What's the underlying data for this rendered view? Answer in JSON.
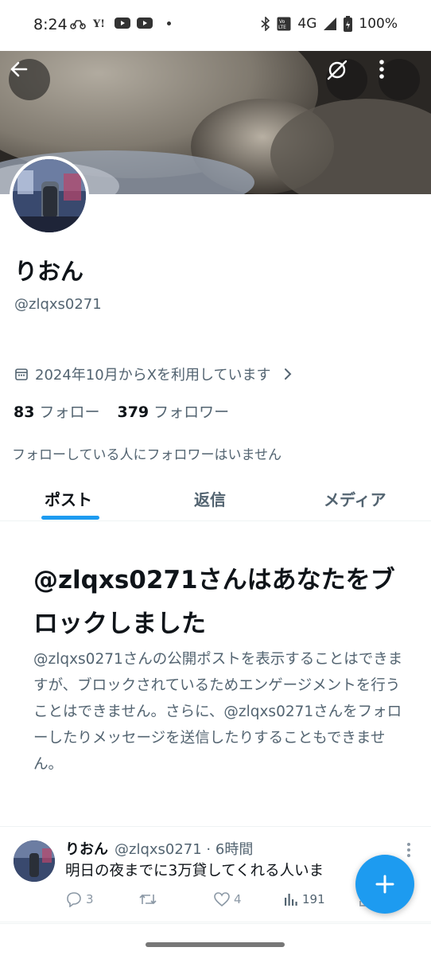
{
  "status_bar": {
    "time": "8:24",
    "network": "4G",
    "battery": "100%",
    "left_icons": [
      "scooter-icon",
      "yahoo-icon",
      "youtube-icon",
      "youtube-icon"
    ],
    "right_icons": [
      "bluetooth-icon",
      "volte-icon",
      "signal-icon",
      "battery-icon"
    ]
  },
  "header": {
    "back_icon": "arrow-left-icon",
    "grok_icon": "grok-icon",
    "more_icon": "more-vertical-icon"
  },
  "profile": {
    "display_name": "りおん",
    "handle": "@zlqxs0271",
    "joined": "2024年10月からXを利用しています",
    "following_count": "83",
    "following_label": "フォロー",
    "followers_count": "379",
    "followers_label": "フォロワー",
    "no_known_followers": "フォローしている人にフォロワーはいません"
  },
  "tabs": [
    {
      "label": "ポスト",
      "active": true
    },
    {
      "label": "返信",
      "active": false
    },
    {
      "label": "メディア",
      "active": false
    }
  ],
  "blocked": {
    "title": "@zlqxs0271さんはあなたをブロックしました",
    "body": "@zlqxs0271さんの公開ポストを表示することはできますが、ブロックされているためエンゲージメントを行うことはできません。さらに、@zlqxs0271さんをフォローしたりメッセージを送信したりすることもできません。"
  },
  "post": {
    "author_name": "りおん",
    "author_meta": "@zlqxs0271 · 6時間",
    "text": "明日の夜までに3万貸してくれる人いま",
    "replies": "3",
    "retweets": "",
    "likes": "4",
    "views": "191"
  },
  "colors": {
    "accent": "#1d9bf0",
    "text_primary": "#0f1419",
    "text_secondary": "#536471"
  }
}
